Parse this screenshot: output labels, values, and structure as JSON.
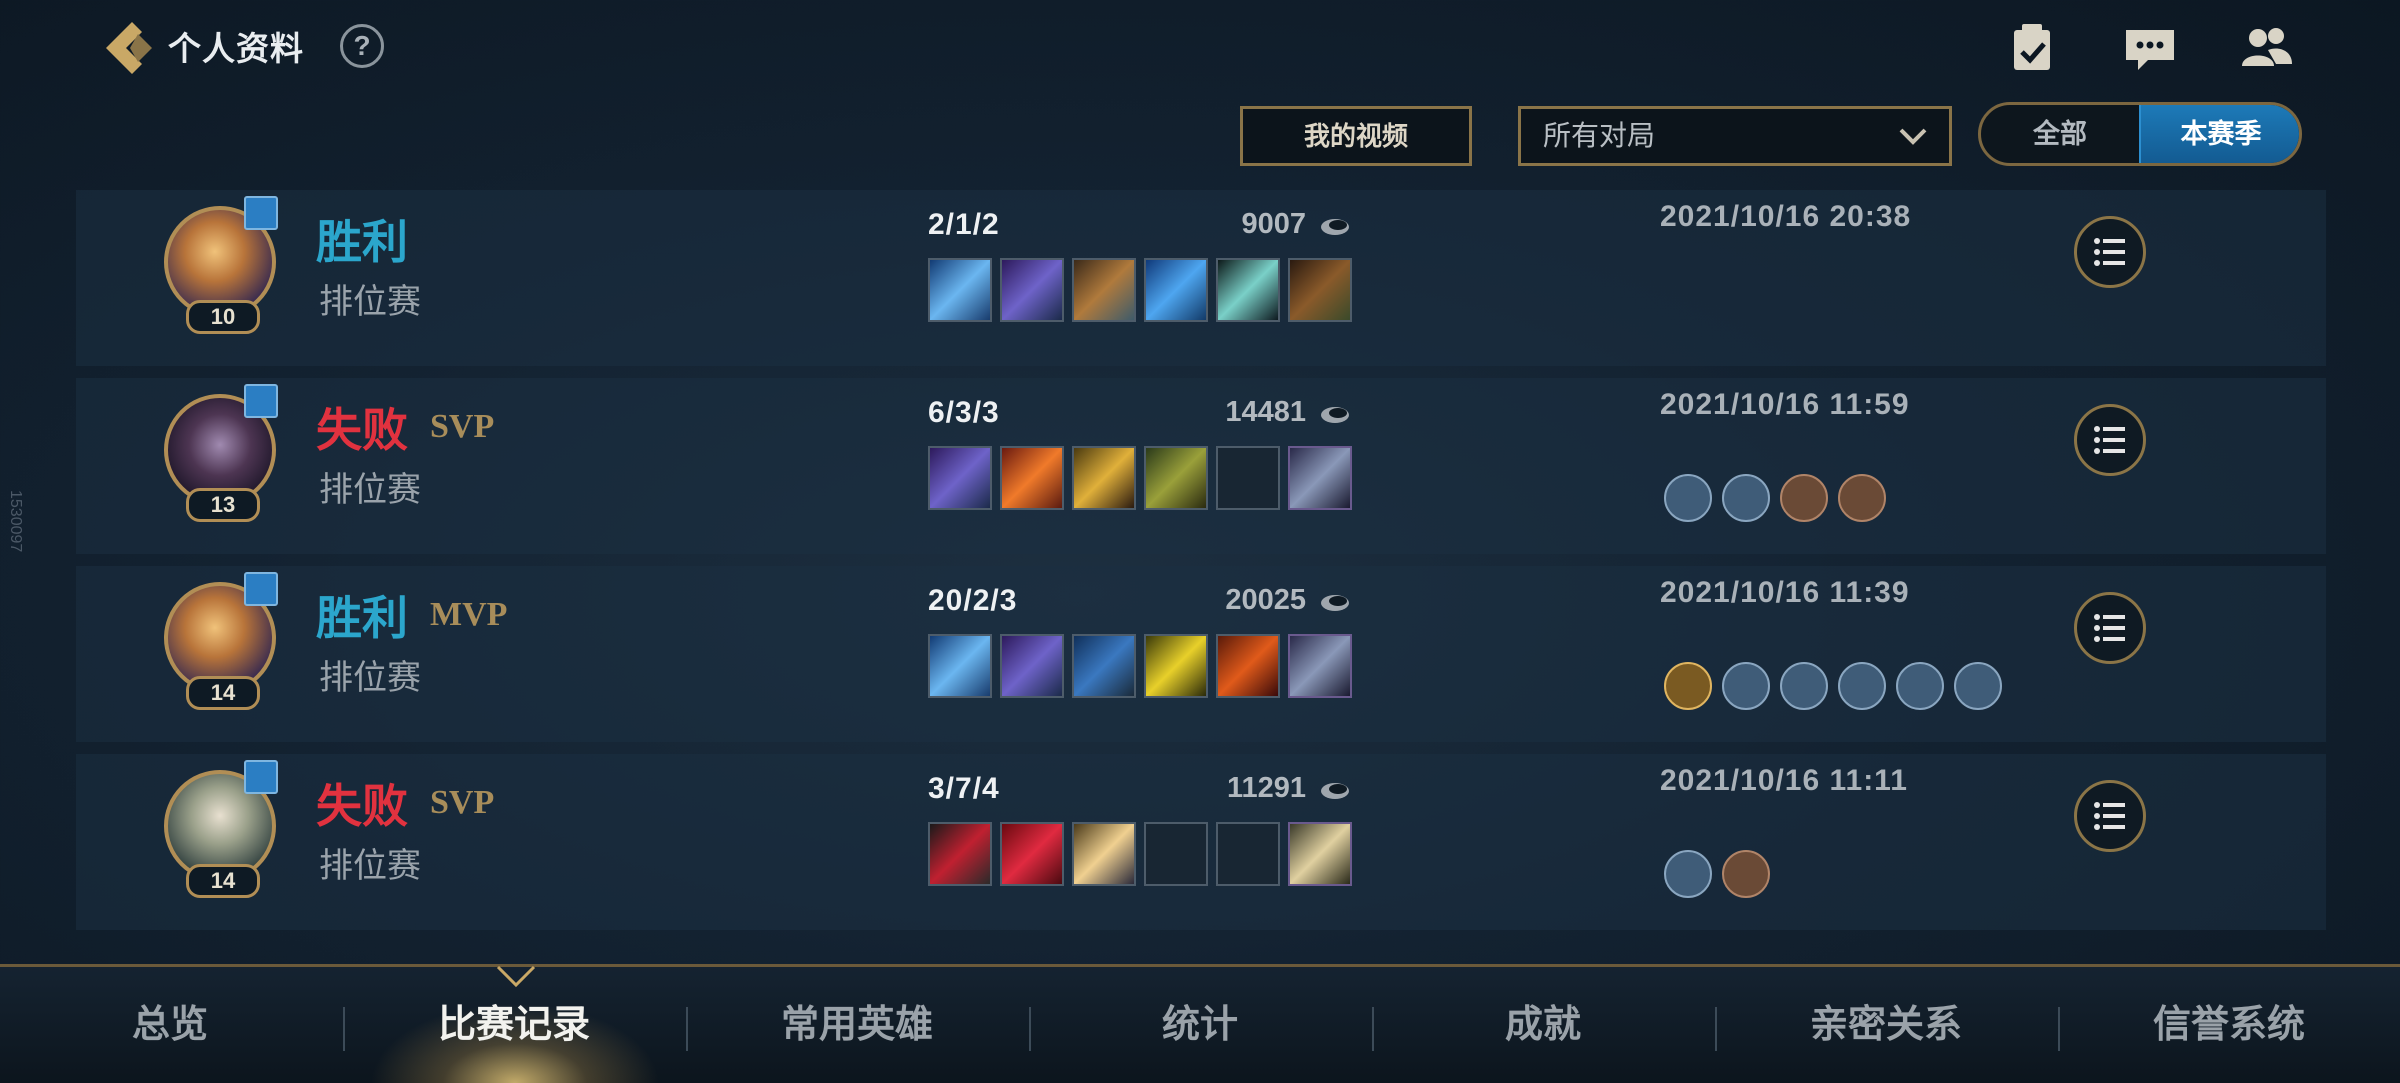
{
  "header": {
    "title": "个人资料",
    "help": "?"
  },
  "filters": {
    "video_label": "我的视频",
    "dropdown_value": "所有对局",
    "seg_all": "全部",
    "seg_season": "本赛季"
  },
  "side_text": "1530097",
  "matches": [
    {
      "level": "10",
      "result": "胜利",
      "result_type": "win",
      "badge": "",
      "mode": "排位赛",
      "kda": "2/1/2",
      "gold": "9007",
      "date": "2021/10/16 20:38"
    },
    {
      "level": "13",
      "result": "失败",
      "result_type": "lose",
      "badge": "SVP",
      "mode": "排位赛",
      "kda": "6/3/3",
      "gold": "14481",
      "date": "2021/10/16 11:59"
    },
    {
      "level": "14",
      "result": "胜利",
      "result_type": "win",
      "badge": "MVP",
      "mode": "排位赛",
      "kda": "20/2/3",
      "gold": "20025",
      "date": "2021/10/16 11:39"
    },
    {
      "level": "14",
      "result": "失败",
      "result_type": "lose",
      "badge": "SVP",
      "mode": "排位赛",
      "kda": "3/7/4",
      "gold": "11291",
      "date": "2021/10/16 11:11"
    }
  ],
  "nav": {
    "tabs": [
      "总览",
      "比赛记录",
      "常用英雄",
      "统计",
      "成就",
      "亲密关系",
      "信誉系统"
    ],
    "active": "比赛记录"
  },
  "colors": {
    "win": "#2ba6cc",
    "lose": "#e1323f",
    "accent_gold": "#b18e55",
    "season_active": "#1d7ab8"
  }
}
